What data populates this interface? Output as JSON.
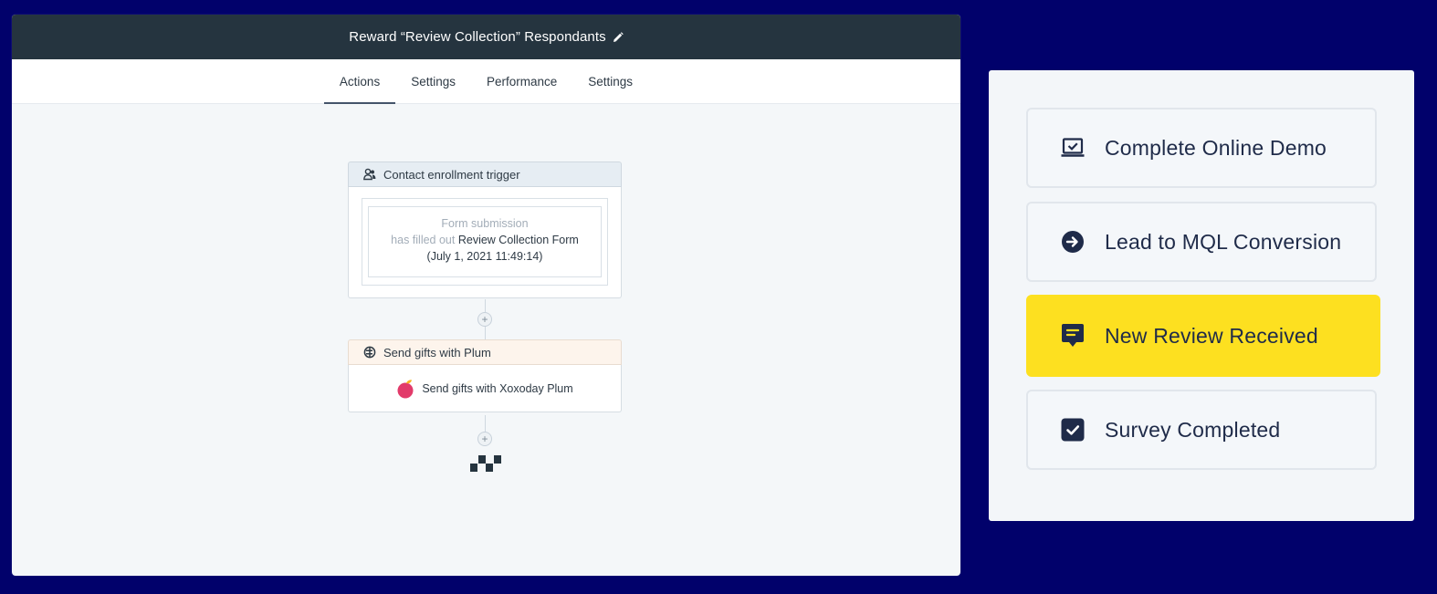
{
  "workflow": {
    "title": "Reward “Review Collection” Respondants",
    "tabs": [
      {
        "label": "Actions",
        "active": true
      },
      {
        "label": "Settings",
        "active": false
      },
      {
        "label": "Performance",
        "active": false
      },
      {
        "label": "Settings",
        "active": false
      }
    ],
    "trigger": {
      "header": "Contact enrollment trigger",
      "icon": "contacts-icon",
      "filter_type": "Form submission",
      "filter_prefix": "has filled out",
      "filter_form": "Review Collection Form",
      "filter_date": "(July 1, 2021 11:49:14)"
    },
    "action": {
      "header": "Send gifts with Plum",
      "icon": "integration-icon",
      "body": "Send gifts with Xoxoday Plum",
      "logo": "plum-logo"
    },
    "add_step_symbol": "+"
  },
  "goals": {
    "items": [
      {
        "label": "Complete Online Demo",
        "icon": "laptop-check-icon",
        "highlighted": false
      },
      {
        "label": "Lead to MQL Conversion",
        "icon": "arrow-circle-icon",
        "highlighted": false
      },
      {
        "label": "New Review Received",
        "icon": "message-icon",
        "highlighted": true
      },
      {
        "label": "Survey Completed",
        "icon": "checkbox-icon",
        "highlighted": false
      }
    ]
  },
  "colors": {
    "background": "#01016b",
    "titlebar": "#25343f",
    "highlight": "#fde020",
    "icon_navy": "#1f2b49"
  }
}
